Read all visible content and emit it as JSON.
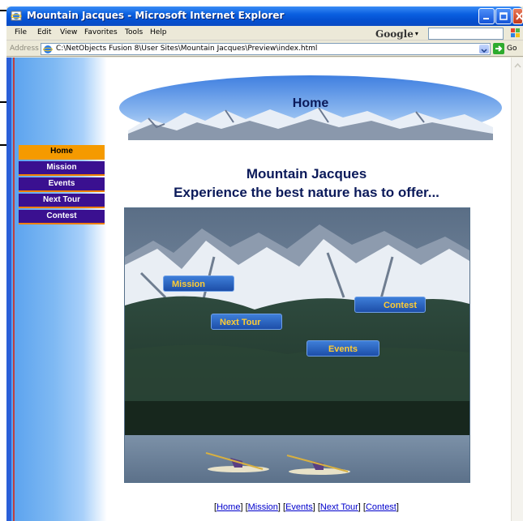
{
  "window": {
    "title": "Mountain Jacques - Microsoft Internet Explorer"
  },
  "menubar": {
    "items": [
      "File",
      "Edit",
      "View",
      "Favorites",
      "Tools",
      "Help"
    ],
    "google_label": "Google"
  },
  "addressbar": {
    "label": "Address",
    "url": "C:\\NetObjects Fusion 8\\User Sites\\Mountain Jacques\\Preview\\index.html",
    "go_label": "Go"
  },
  "page": {
    "banner_title": "Home",
    "nav": [
      "Home",
      "Mission",
      "Events",
      "Next Tour",
      "Contest"
    ],
    "active_nav": "Home",
    "headline_1": "Mountain Jacques",
    "headline_2": "Experience the best nature has to offer...",
    "image_buttons": {
      "mission": "Mission",
      "next_tour": "Next Tour",
      "contest": "Contest",
      "events": "Events"
    },
    "footer_links": [
      "Home",
      "Mission",
      "Events",
      "Next Tour",
      "Contest"
    ]
  },
  "colors": {
    "nav_bg": "#3a1090",
    "nav_active": "#f59a00",
    "accent_orange": "#f08000",
    "headline": "#0b1a5a"
  }
}
